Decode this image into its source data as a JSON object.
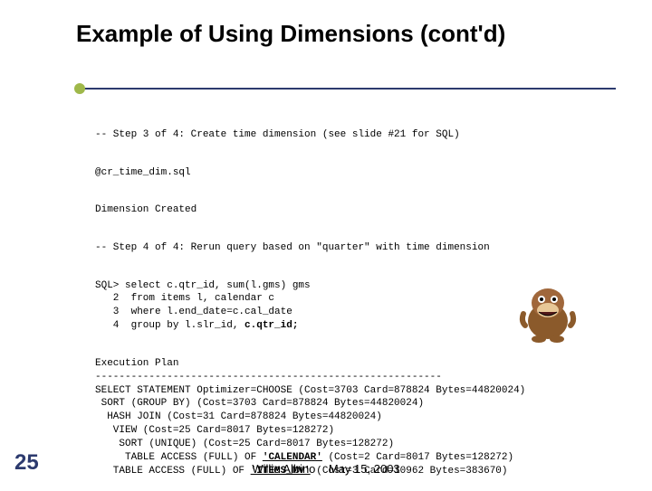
{
  "title": "Example of Using Dimensions (cont'd)",
  "step3": "-- Step 3 of 4: Create time dimension (see slide #21 for SQL)",
  "script_cmd": "@cr_time_dim.sql",
  "dim_created": "Dimension Created",
  "step4": "-- Step 4 of 4: Rerun query based on \"quarter\" with time dimension",
  "sql_line1": "SQL> select c.qtr_id, sum(l.gms) gms",
  "sql_line2": "   2  from items l, calendar c",
  "sql_line3": "   3  where l.end_date=c.cal_date",
  "sql_line4_a": "   4  group by l.slr_id, ",
  "sql_line4_b": "c.qtr_id;",
  "plan_head": "Execution Plan",
  "plan_dash": "----------------------------------------------------------",
  "plan_l1": "SELECT STATEMENT Optimizer=CHOOSE (Cost=3703 Card=878824 Bytes=44820024)",
  "plan_l2": " SORT (GROUP BY) (Cost=3703 Card=878824 Bytes=44820024)",
  "plan_l3": "  HASH JOIN (Cost=31 Card=878824 Bytes=44820024)",
  "plan_l4": "   VIEW (Cost=25 Card=8017 Bytes=128272)",
  "plan_l5": "    SORT (UNIQUE) (Cost=25 Card=8017 Bytes=128272)",
  "plan_l6a": "     TABLE ACCESS (FULL) OF ",
  "plan_l6b": "'CALENDAR'",
  "plan_l6c": " (Cost=2 Card=8017 Bytes=128272)",
  "plan_l7a": "   TABLE ACCESS (FULL) OF ",
  "plan_l7b": "'ITEMS_MV'",
  "plan_l7c": " (Cost=3 Card=10962 Bytes=383670)",
  "slide_number": "25",
  "footer_author": "Willie Albino",
  "footer_date": "May 15, 2003"
}
